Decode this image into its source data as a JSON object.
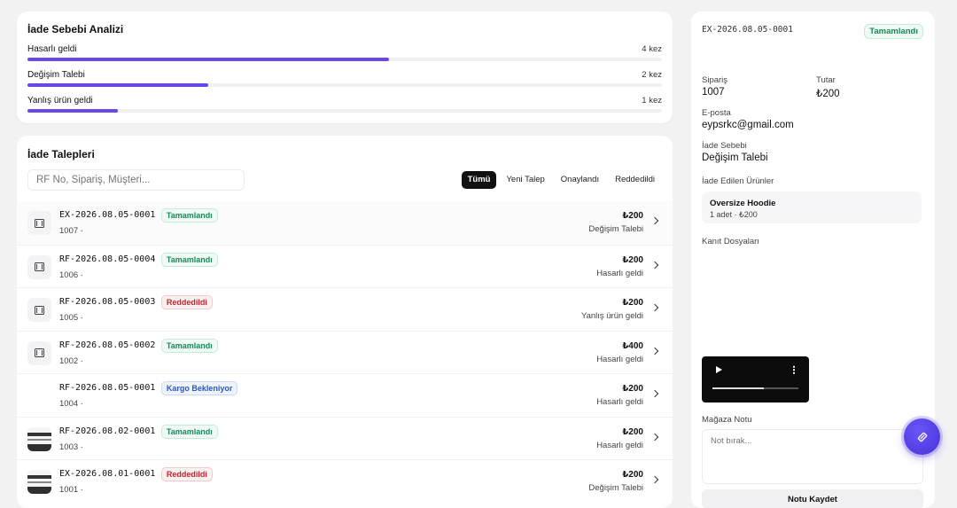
{
  "analysis": {
    "title": "İade Sebebi Analizi",
    "reasons": [
      {
        "label": "Hasarlı geldi",
        "count": "4 kez",
        "share": 0.57
      },
      {
        "label": "Değişim Talebi",
        "count": "2 kez",
        "share": 0.285
      },
      {
        "label": "Yanlış ürün geldi",
        "count": "1 kez",
        "share": 0.143
      }
    ],
    "bar_color": "#6c47e6"
  },
  "requests": {
    "title": "İade Talepleri",
    "search_placeholder": "RF No, Sipariş, Müşteri...",
    "filters": [
      "Tümü",
      "Yeni Talep",
      "Onaylandı",
      "Reddedildi"
    ],
    "active_filter": "Tümü",
    "rows": [
      {
        "id": "EX-2026.08.05-0001",
        "status": "Tamamlandı",
        "order": "1007 ·",
        "amount": "₺200",
        "reason": "Değişim Talebi",
        "thumb": "film-icon"
      },
      {
        "id": "RF-2026.08.05-0004",
        "status": "Tamamlandı",
        "order": "1006 ·",
        "amount": "₺200",
        "reason": "Hasarlı geldi",
        "thumb": "film-icon"
      },
      {
        "id": "RF-2026.08.05-0003",
        "status": "Reddedildi",
        "order": "1005 ·",
        "amount": "₺200",
        "reason": "Yanlış ürün geldi",
        "thumb": "film-icon"
      },
      {
        "id": "RF-2026.08.05-0002",
        "status": "Tamamlandı",
        "order": "1002 ·",
        "amount": "₺400",
        "reason": "Hasarlı geldi",
        "thumb": "film-icon"
      },
      {
        "id": "RF-2026.08.05-0001",
        "status": "Kargo Bekleniyor",
        "order": "1004 ·",
        "amount": "₺200",
        "reason": "Hasarlı geldi",
        "thumb": "none"
      },
      {
        "id": "RF-2026.08.02-0001",
        "status": "Tamamlandı",
        "order": "1003 ·",
        "amount": "₺200",
        "reason": "Hasarlı geldi",
        "thumb": "photo"
      },
      {
        "id": "EX-2026.08.01-0001",
        "status": "Reddedildi",
        "order": "1001 ·",
        "amount": "₺200",
        "reason": "Değişim Talebi",
        "thumb": "photo"
      }
    ]
  },
  "detail": {
    "id": "EX-2026.08.05-0001",
    "status": "Tamamlandı",
    "order_label": "Sipariş",
    "order_value": "1007",
    "total_label": "Tutar",
    "total_value": "₺200",
    "email_label": "E-posta",
    "email_value": "eypsrkc@gmail.com",
    "reason_label": "İade Sebebi",
    "reason_value": "Değişim Talebi",
    "products_label": "İade Edilen Ürünler",
    "product_name": "Oversize Hoodie",
    "product_detail": "1 adet · ₺200",
    "evidence_label": "Kanıt Dosyaları",
    "video_progress": 0.6,
    "store_note_label": "Mağaza Notu",
    "note_placeholder": "Not bırak...",
    "save_label": "Notu Kaydet"
  },
  "colors": {
    "accent": "#6c47e6",
    "success": "#158a5a",
    "danger": "#c2262e",
    "info": "#2a58c8"
  }
}
